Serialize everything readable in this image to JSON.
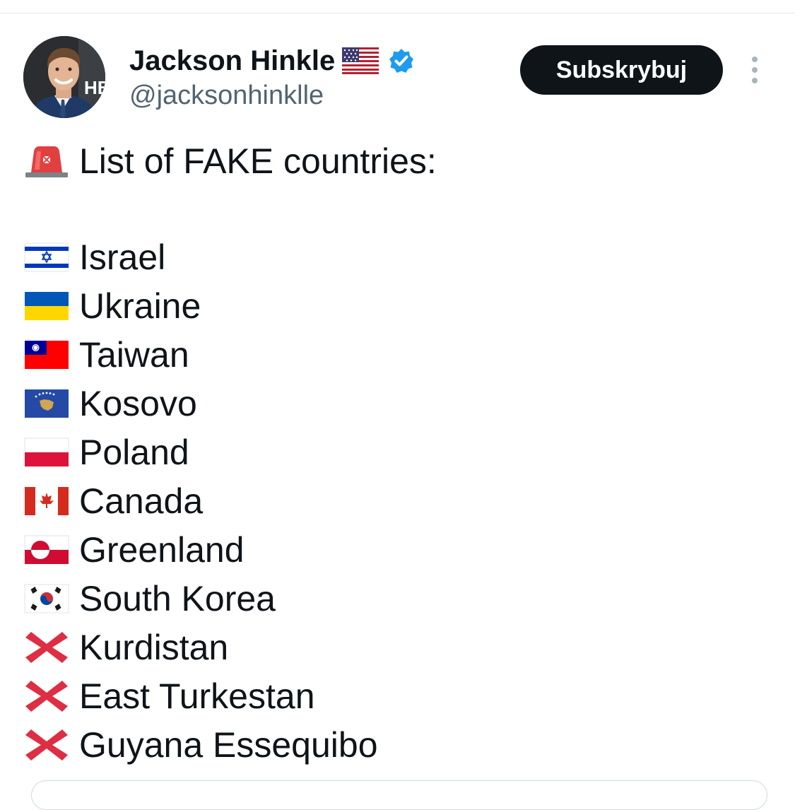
{
  "author": {
    "display_name": "Jackson Hinkle",
    "handle": "@jacksonhinklle",
    "avatar_logo_text": "HB"
  },
  "header": {
    "subscribe_label": "Subskrybuj"
  },
  "tweet": {
    "headline": "List of FAKE countries:",
    "headline_icon": "police-light-icon",
    "items": [
      {
        "label": "Israel",
        "icon": "flag-israel-icon"
      },
      {
        "label": "Ukraine",
        "icon": "flag-ukraine-icon"
      },
      {
        "label": "Taiwan",
        "icon": "flag-taiwan-icon"
      },
      {
        "label": "Kosovo",
        "icon": "flag-kosovo-icon"
      },
      {
        "label": "Poland",
        "icon": "flag-poland-icon"
      },
      {
        "label": "Canada",
        "icon": "flag-canada-icon"
      },
      {
        "label": "Greenland",
        "icon": "flag-greenland-icon"
      },
      {
        "label": "South Korea",
        "icon": "flag-south-korea-icon"
      },
      {
        "label": "Kurdistan",
        "icon": "cross-mark-icon"
      },
      {
        "label": "East Turkestan",
        "icon": "cross-mark-icon"
      },
      {
        "label": "Guyana Essequibo",
        "icon": "cross-mark-icon"
      }
    ]
  },
  "colors": {
    "text": "#0f1419",
    "secondary_text": "#536471",
    "verified_blue": "#1d9bf0",
    "button_bg": "#0f1419",
    "button_text": "#ffffff",
    "cross_red": "#dd2e44"
  }
}
